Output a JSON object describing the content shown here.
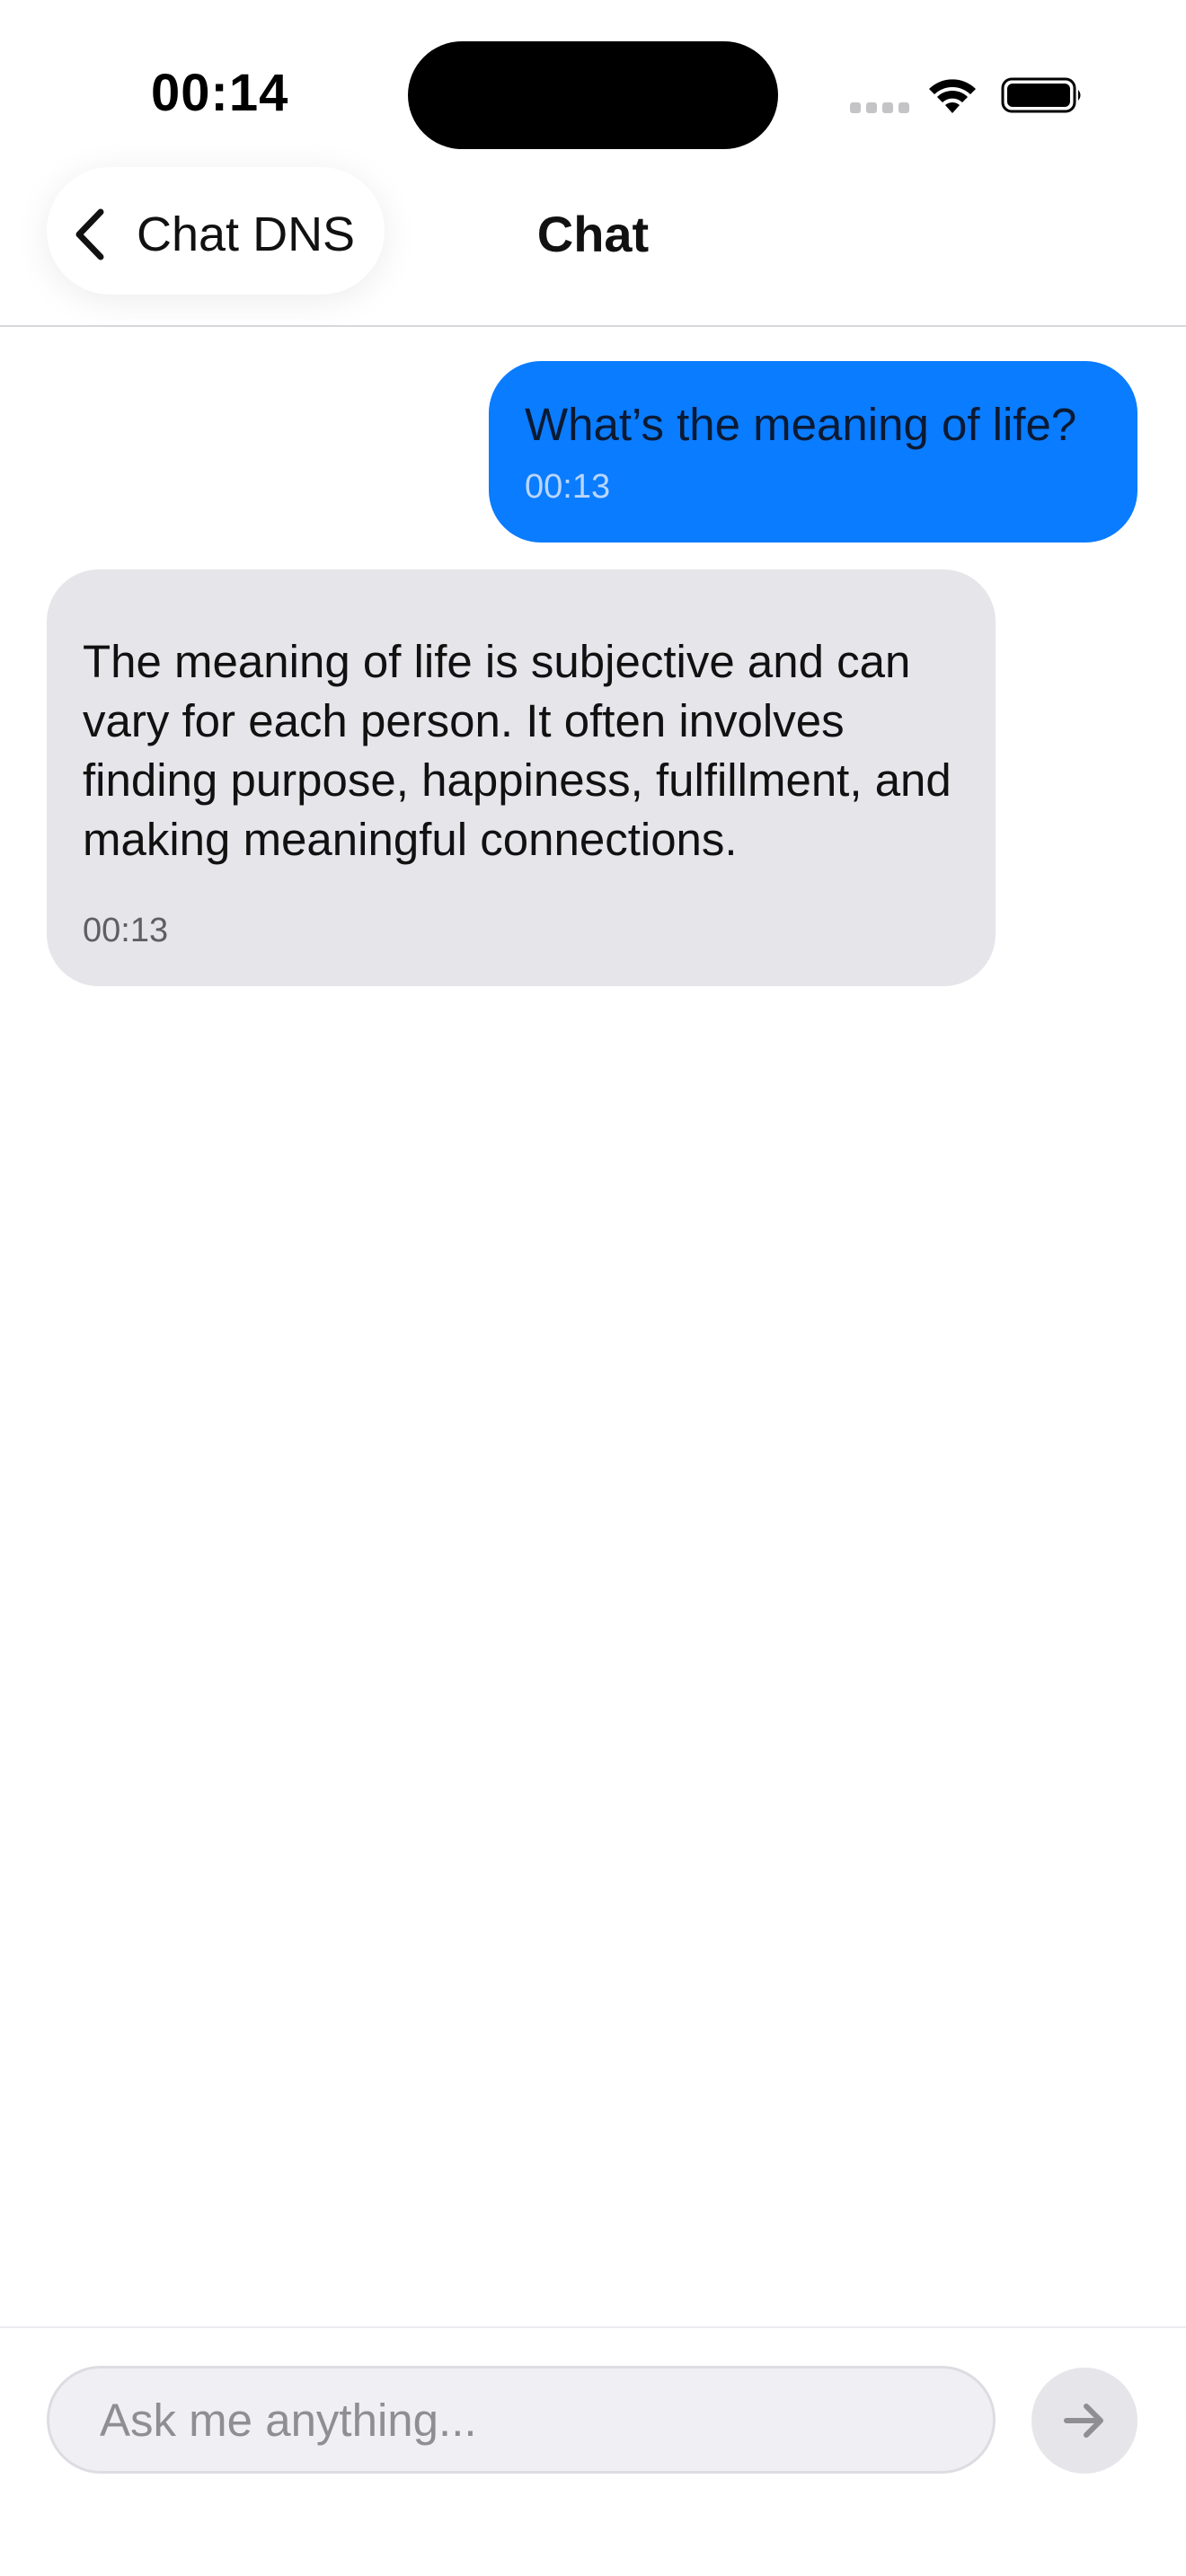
{
  "status_bar": {
    "time": "00:14",
    "signal_icon": "cellular-signal-icon",
    "wifi_icon": "wifi-icon",
    "battery_icon": "battery-icon"
  },
  "nav": {
    "back_label": "Chat DNS",
    "back_icon": "chevron-left-icon",
    "title": "Chat"
  },
  "messages": [
    {
      "role": "user",
      "text": "What’s the meaning of life?",
      "time": "00:13"
    },
    {
      "role": "assistant",
      "text": "The meaning of life is subjective and can vary for each person. It often involves finding purpose, happiness, fulfillment, and making meaningful connections.",
      "time": "00:13"
    }
  ],
  "composer": {
    "value": "",
    "placeholder": "Ask me anything...",
    "send_icon": "arrow-right-icon"
  },
  "colors": {
    "user_bubble": "#0a7cff",
    "assistant_bubble": "#e5e5ea",
    "send_button": "#e5e5ea"
  }
}
